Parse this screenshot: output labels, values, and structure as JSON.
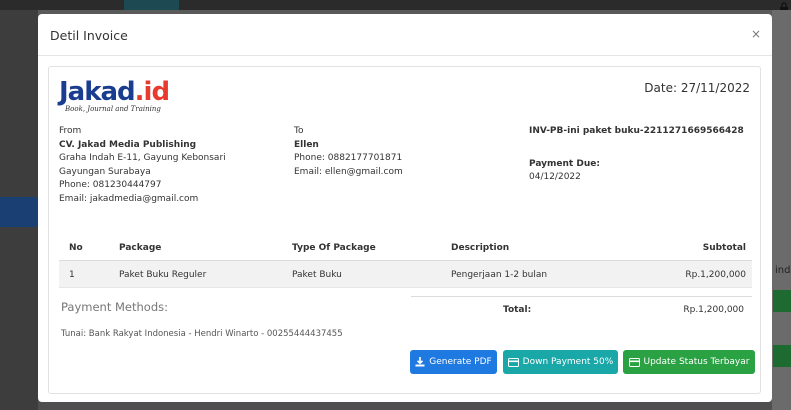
{
  "modal": {
    "title": "Detil Invoice",
    "close_label": "×"
  },
  "company": {
    "logo_main": "Jakad",
    "logo_suffix": ".id",
    "logo_tagline": "Book, Journal and Training"
  },
  "invoice": {
    "date": "Date: 27/11/2022",
    "number": "INV-PB-ini paket buku-2211271669566428",
    "payment_due_label": "Payment Due:",
    "payment_due_date": "04/12/2022"
  },
  "from": {
    "label": "From",
    "name": "CV. Jakad Media Publishing",
    "address1": "Graha Indah E-11, Gayung Kebonsari",
    "address2": "Gayungan Surabaya",
    "phone": "Phone: 081230444797",
    "email": "Email: jakadmedia@gmail.com"
  },
  "to": {
    "label": "To",
    "name": "Ellen",
    "phone": "Phone: 0882177701871",
    "email": "Email: ellen@gmail.com"
  },
  "table": {
    "headers": [
      "No",
      "Package",
      "Type Of Package",
      "Description",
      "Subtotal"
    ],
    "rows": [
      [
        "1",
        "Paket Buku Reguler",
        "Paket Buku",
        "Pengerjaan 1-2 bulan",
        "Rp.1,200,000"
      ]
    ]
  },
  "payment_methods": {
    "title": "Payment Methods:",
    "text": "Tunai: Bank Rakyat Indonesia - Hendri Winarto - 00255444437455"
  },
  "total": {
    "label": "Total:",
    "value": "Rp.1,200,000"
  },
  "buttons": {
    "pdf": "Generate PDF",
    "down_payment": "Down Payment 50%",
    "update_status": "Update Status Terbayar"
  },
  "background": {
    "right_text": "ind"
  },
  "colors": {
    "logo_blue": "#1b3d8f",
    "logo_red": "#e83b2e",
    "btn_primary": "#1e7ae0",
    "btn_info": "#1aa7a7",
    "btn_success": "#2aa244"
  }
}
